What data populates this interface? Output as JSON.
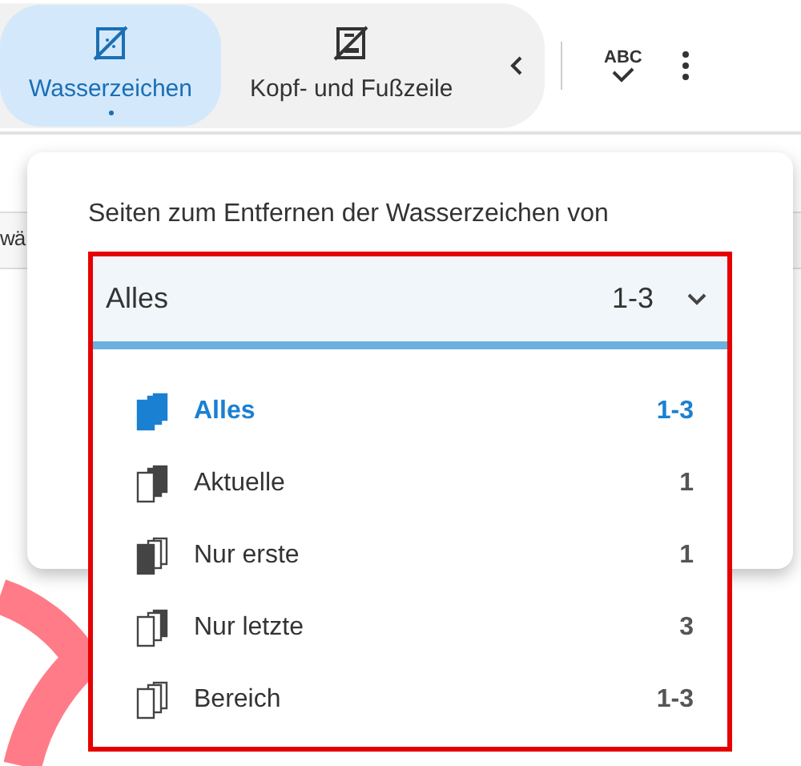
{
  "toolbar": {
    "tabs": [
      {
        "label": "Wasserzeichen",
        "selected": true
      },
      {
        "label": "Kopf- und Fußzeile",
        "selected": false
      }
    ],
    "spellcheck_label": "ABC"
  },
  "document": {
    "partial_text": "wä"
  },
  "panel": {
    "label": "Seiten zum Entfernen der Wasserzeichen von",
    "dropdown": {
      "value": "Alles",
      "range": "1-3",
      "expanded": true,
      "options": [
        {
          "kind": "all",
          "label": "Alles",
          "range": "1-3",
          "selected": true
        },
        {
          "kind": "current",
          "label": "Aktuelle",
          "range": "1",
          "selected": false
        },
        {
          "kind": "first",
          "label": "Nur erste",
          "range": "1",
          "selected": false
        },
        {
          "kind": "last",
          "label": "Nur letzte",
          "range": "3",
          "selected": false
        },
        {
          "kind": "range",
          "label": "Bereich",
          "range": "1-3",
          "selected": false
        }
      ]
    }
  }
}
